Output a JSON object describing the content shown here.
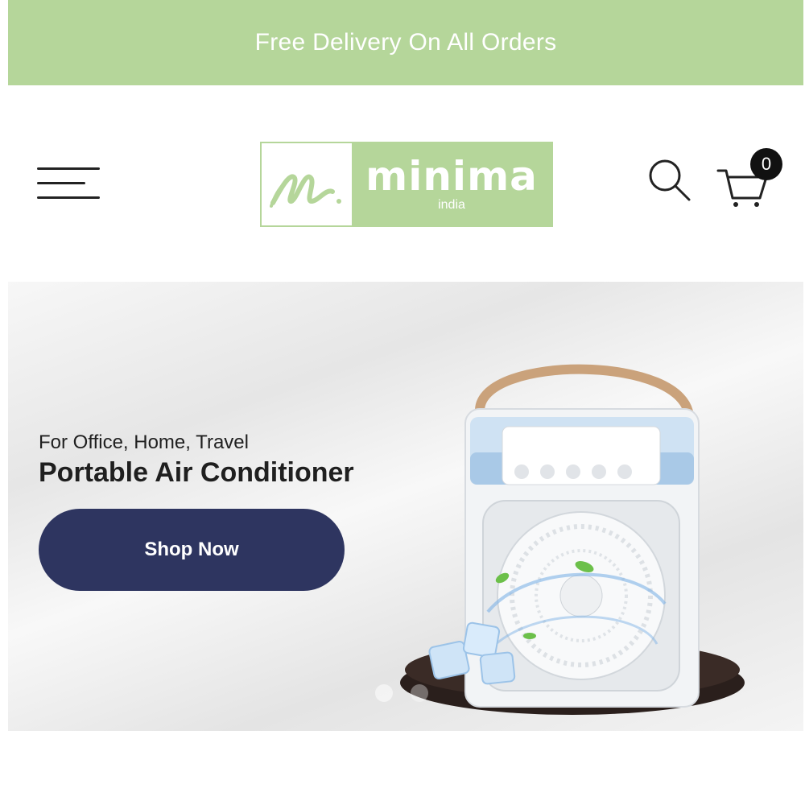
{
  "announcement": {
    "text": "Free Delivery On All Orders"
  },
  "header": {
    "logo": {
      "word": "minima",
      "sub": "india"
    },
    "cart": {
      "count": "0"
    }
  },
  "hero": {
    "subtitle": "For Office, Home, Travel",
    "title": "Portable Air Conditioner",
    "cta_label": "Shop Now",
    "slides": 2,
    "active_slide": 1
  },
  "colors": {
    "brand_green": "#b5d69a",
    "cta_navy": "#2e3560",
    "text_dark": "#1f1f1f"
  },
  "icons": [
    "menu-icon",
    "search-icon",
    "cart-icon"
  ]
}
